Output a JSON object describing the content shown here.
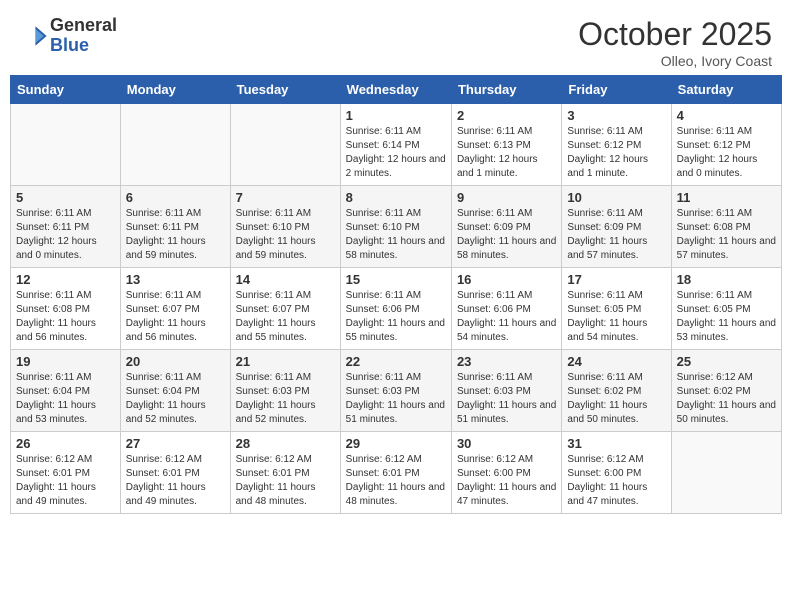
{
  "header": {
    "logo_general": "General",
    "logo_blue": "Blue",
    "month": "October 2025",
    "location": "Olleo, Ivory Coast"
  },
  "days_of_week": [
    "Sunday",
    "Monday",
    "Tuesday",
    "Wednesday",
    "Thursday",
    "Friday",
    "Saturday"
  ],
  "weeks": [
    [
      {
        "day": "",
        "info": ""
      },
      {
        "day": "",
        "info": ""
      },
      {
        "day": "",
        "info": ""
      },
      {
        "day": "1",
        "info": "Sunrise: 6:11 AM\nSunset: 6:14 PM\nDaylight: 12 hours and 2 minutes."
      },
      {
        "day": "2",
        "info": "Sunrise: 6:11 AM\nSunset: 6:13 PM\nDaylight: 12 hours and 1 minute."
      },
      {
        "day": "3",
        "info": "Sunrise: 6:11 AM\nSunset: 6:12 PM\nDaylight: 12 hours and 1 minute."
      },
      {
        "day": "4",
        "info": "Sunrise: 6:11 AM\nSunset: 6:12 PM\nDaylight: 12 hours and 0 minutes."
      }
    ],
    [
      {
        "day": "5",
        "info": "Sunrise: 6:11 AM\nSunset: 6:11 PM\nDaylight: 12 hours and 0 minutes."
      },
      {
        "day": "6",
        "info": "Sunrise: 6:11 AM\nSunset: 6:11 PM\nDaylight: 11 hours and 59 minutes."
      },
      {
        "day": "7",
        "info": "Sunrise: 6:11 AM\nSunset: 6:10 PM\nDaylight: 11 hours and 59 minutes."
      },
      {
        "day": "8",
        "info": "Sunrise: 6:11 AM\nSunset: 6:10 PM\nDaylight: 11 hours and 58 minutes."
      },
      {
        "day": "9",
        "info": "Sunrise: 6:11 AM\nSunset: 6:09 PM\nDaylight: 11 hours and 58 minutes."
      },
      {
        "day": "10",
        "info": "Sunrise: 6:11 AM\nSunset: 6:09 PM\nDaylight: 11 hours and 57 minutes."
      },
      {
        "day": "11",
        "info": "Sunrise: 6:11 AM\nSunset: 6:08 PM\nDaylight: 11 hours and 57 minutes."
      }
    ],
    [
      {
        "day": "12",
        "info": "Sunrise: 6:11 AM\nSunset: 6:08 PM\nDaylight: 11 hours and 56 minutes."
      },
      {
        "day": "13",
        "info": "Sunrise: 6:11 AM\nSunset: 6:07 PM\nDaylight: 11 hours and 56 minutes."
      },
      {
        "day": "14",
        "info": "Sunrise: 6:11 AM\nSunset: 6:07 PM\nDaylight: 11 hours and 55 minutes."
      },
      {
        "day": "15",
        "info": "Sunrise: 6:11 AM\nSunset: 6:06 PM\nDaylight: 11 hours and 55 minutes."
      },
      {
        "day": "16",
        "info": "Sunrise: 6:11 AM\nSunset: 6:06 PM\nDaylight: 11 hours and 54 minutes."
      },
      {
        "day": "17",
        "info": "Sunrise: 6:11 AM\nSunset: 6:05 PM\nDaylight: 11 hours and 54 minutes."
      },
      {
        "day": "18",
        "info": "Sunrise: 6:11 AM\nSunset: 6:05 PM\nDaylight: 11 hours and 53 minutes."
      }
    ],
    [
      {
        "day": "19",
        "info": "Sunrise: 6:11 AM\nSunset: 6:04 PM\nDaylight: 11 hours and 53 minutes."
      },
      {
        "day": "20",
        "info": "Sunrise: 6:11 AM\nSunset: 6:04 PM\nDaylight: 11 hours and 52 minutes."
      },
      {
        "day": "21",
        "info": "Sunrise: 6:11 AM\nSunset: 6:03 PM\nDaylight: 11 hours and 52 minutes."
      },
      {
        "day": "22",
        "info": "Sunrise: 6:11 AM\nSunset: 6:03 PM\nDaylight: 11 hours and 51 minutes."
      },
      {
        "day": "23",
        "info": "Sunrise: 6:11 AM\nSunset: 6:03 PM\nDaylight: 11 hours and 51 minutes."
      },
      {
        "day": "24",
        "info": "Sunrise: 6:11 AM\nSunset: 6:02 PM\nDaylight: 11 hours and 50 minutes."
      },
      {
        "day": "25",
        "info": "Sunrise: 6:12 AM\nSunset: 6:02 PM\nDaylight: 11 hours and 50 minutes."
      }
    ],
    [
      {
        "day": "26",
        "info": "Sunrise: 6:12 AM\nSunset: 6:01 PM\nDaylight: 11 hours and 49 minutes."
      },
      {
        "day": "27",
        "info": "Sunrise: 6:12 AM\nSunset: 6:01 PM\nDaylight: 11 hours and 49 minutes."
      },
      {
        "day": "28",
        "info": "Sunrise: 6:12 AM\nSunset: 6:01 PM\nDaylight: 11 hours and 48 minutes."
      },
      {
        "day": "29",
        "info": "Sunrise: 6:12 AM\nSunset: 6:01 PM\nDaylight: 11 hours and 48 minutes."
      },
      {
        "day": "30",
        "info": "Sunrise: 6:12 AM\nSunset: 6:00 PM\nDaylight: 11 hours and 47 minutes."
      },
      {
        "day": "31",
        "info": "Sunrise: 6:12 AM\nSunset: 6:00 PM\nDaylight: 11 hours and 47 minutes."
      },
      {
        "day": "",
        "info": ""
      }
    ]
  ]
}
